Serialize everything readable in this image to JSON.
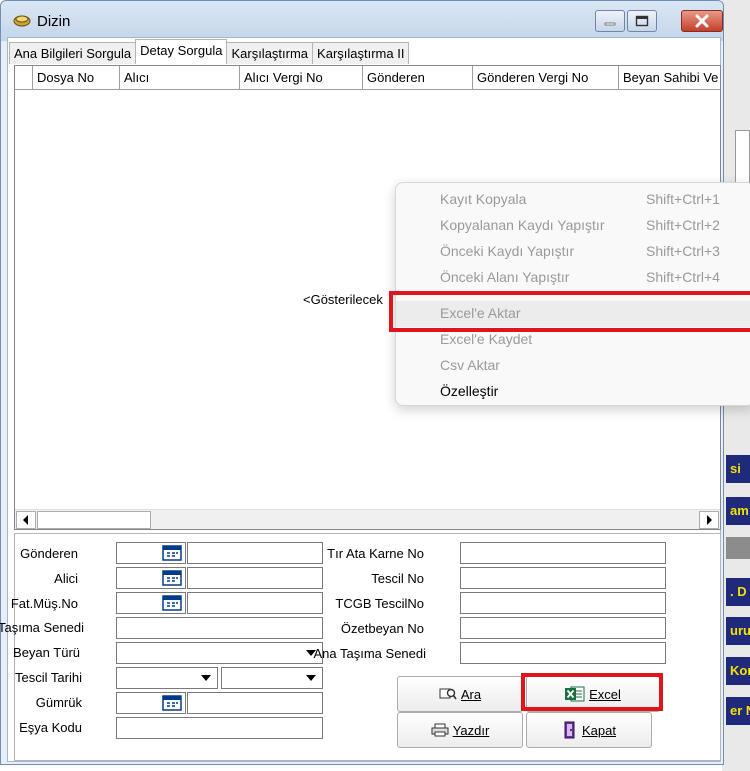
{
  "window": {
    "title": "Dizin"
  },
  "tabs": [
    {
      "label": "Ana Bilgileri Sorgula",
      "active": false
    },
    {
      "label": "Detay Sorgula",
      "active": true
    },
    {
      "label": "Karşılaştırma",
      "active": false
    },
    {
      "label": "Karşılaştırma II",
      "active": false
    }
  ],
  "grid": {
    "columns": [
      "Dosya No",
      "Alıcı",
      "Alıcı Vergi No",
      "Gönderen",
      "Gönderen Vergi No",
      "Beyan Sahibi Ve"
    ],
    "empty_text": "<Gösterilecek"
  },
  "context_menu": {
    "items": [
      {
        "label": "Kayıt Kopyala",
        "shortcut": "Shift+Ctrl+1",
        "enabled": false
      },
      {
        "label": "Kopyalanan Kaydı Yapıştır",
        "shortcut": "Shift+Ctrl+2",
        "enabled": false
      },
      {
        "label": "Önceki Kaydı Yapıştır",
        "shortcut": "Shift+Ctrl+3",
        "enabled": false
      },
      {
        "label": "Önceki Alanı Yapıştır",
        "shortcut": "Shift+Ctrl+4",
        "enabled": false
      },
      {
        "label": "Excel'e Aktar",
        "shortcut": "",
        "enabled": false,
        "highlighted": true
      },
      {
        "label": "Excel'e Kaydet",
        "shortcut": "",
        "enabled": false
      },
      {
        "label": "Csv Aktar",
        "shortcut": "",
        "enabled": false
      },
      {
        "label": "Özelleştir",
        "shortcut": "",
        "enabled": true
      }
    ]
  },
  "form": {
    "left": {
      "gonderen": "Gönderen",
      "alici": "Alici",
      "fat_mus_no": "Fat.Müş.No",
      "tasima_senedi": "Taşıma Senedi",
      "beyan_turu": "Beyan Türü",
      "tescil_tarihi": "Tescil Tarihi",
      "gumruk": "Gümrük",
      "esya_kodu": "Eşya Kodu"
    },
    "right": {
      "tir_ata_karne_no": "Tır Ata Karne No",
      "tescil_no": "Tescil No",
      "tcgb_tescil_no": "TCGB TescilNo",
      "ozetbeyan_no": "Özetbeyan No",
      "ana_tasima_senedi": "Ana Taşıma Senedi"
    }
  },
  "buttons": {
    "ara": "Ara",
    "excel": "Excel",
    "yazdir": "Yazdır",
    "kapat": "Kapat"
  },
  "background_app": {
    "fragments": [
      "si",
      "am",
      ". D",
      "uru",
      "Kor",
      "er N"
    ]
  },
  "colors": {
    "highlight": "#e0141b",
    "background_navy": "#1f2a7a",
    "background_text_yellow": "#f2e400"
  }
}
